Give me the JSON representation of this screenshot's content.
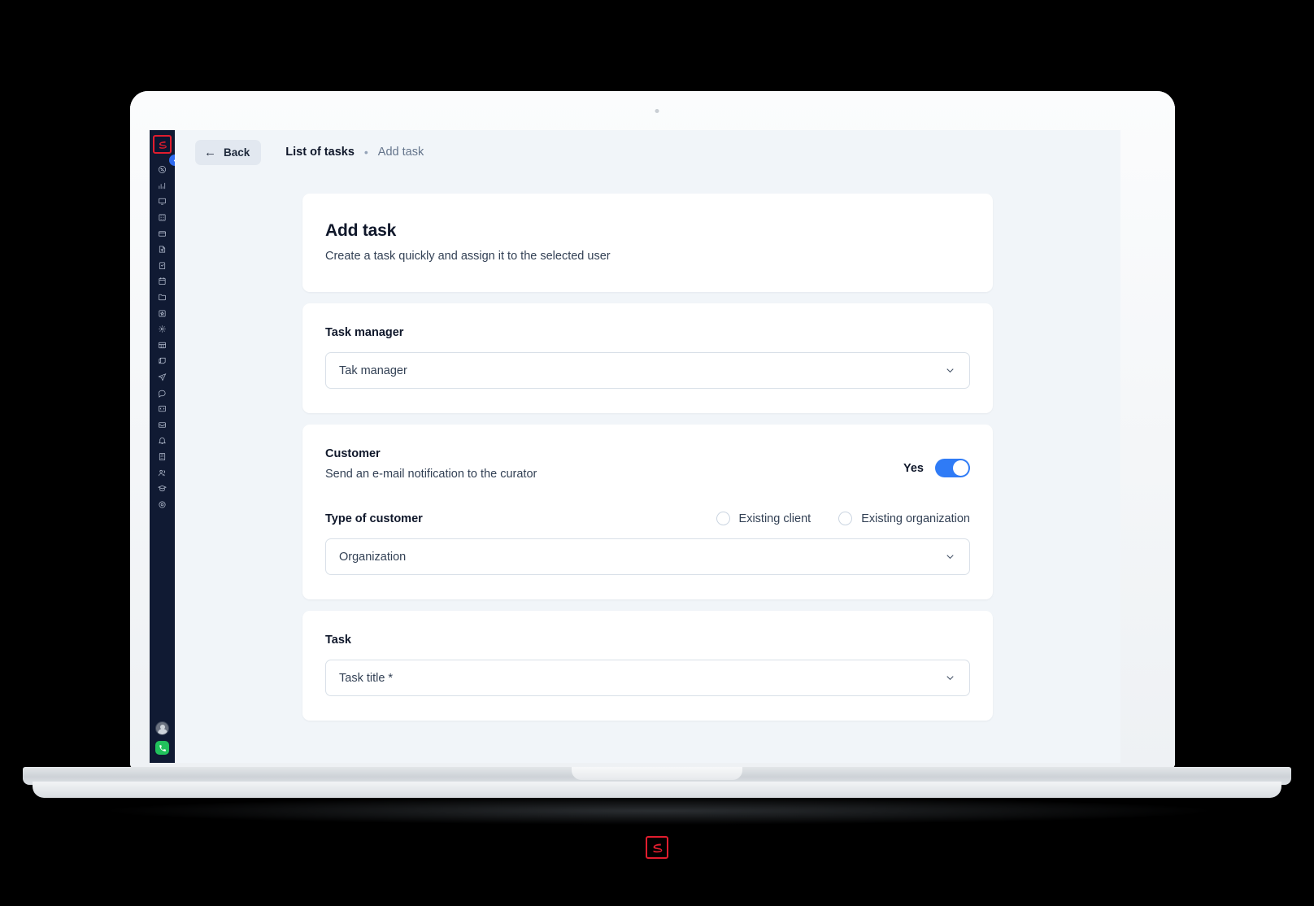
{
  "app": {
    "logo_name": "s-logo",
    "collapse_icon": "chevron-left-icon"
  },
  "sidebar": {
    "items": [
      {
        "icon": "percent-badge-icon",
        "label": "Discounts"
      },
      {
        "icon": "analytics-chart-icon",
        "label": "Analytics"
      },
      {
        "icon": "monitor-icon",
        "label": "Desktop"
      },
      {
        "icon": "building-icon",
        "label": "Company"
      },
      {
        "icon": "card-icon",
        "label": "Cards"
      },
      {
        "icon": "document-edit-icon",
        "label": "Documents"
      },
      {
        "icon": "clipboard-check-icon",
        "label": "Tasks"
      },
      {
        "icon": "calendar-icon",
        "label": "Calendar"
      },
      {
        "icon": "folder-icon",
        "label": "Files"
      },
      {
        "icon": "box-star-icon",
        "label": "Products"
      },
      {
        "icon": "settings-gear-icon",
        "label": "Configuration"
      },
      {
        "icon": "grid-table-icon",
        "label": "Tables"
      },
      {
        "icon": "archive-icon",
        "label": "Archive"
      },
      {
        "icon": "send-icon",
        "label": "Send"
      },
      {
        "icon": "chat-icon",
        "label": "Chat"
      },
      {
        "icon": "code-icon",
        "label": "Code"
      },
      {
        "icon": "inbox-icon",
        "label": "Inbox"
      },
      {
        "icon": "bell-icon",
        "label": "Notifications"
      },
      {
        "icon": "calculator-icon",
        "label": "Calculator"
      },
      {
        "icon": "users-icon",
        "label": "Users"
      },
      {
        "icon": "graduation-cap-icon",
        "label": "Learning"
      },
      {
        "icon": "gear-icon",
        "label": "Settings"
      }
    ],
    "avatar_name": "user-avatar",
    "support_button": {
      "icon": "support-phone-icon",
      "color": "#21c15c"
    }
  },
  "topbar": {
    "back_label": "Back",
    "back_icon": "arrow-left-icon",
    "breadcrumb": {
      "parent": "List of tasks",
      "separator": "•",
      "current": "Add task"
    }
  },
  "main": {
    "header_card": {
      "title": "Add task",
      "subtitle": "Create a task quickly and assign it to the selected user"
    },
    "task_manager_card": {
      "label": "Task manager",
      "select_placeholder": "Tak manager",
      "chevron_icon": "chevron-down-icon"
    },
    "customer_card": {
      "title": "Customer",
      "description": "Send an e-mail notification to the curator",
      "toggle_label": "Yes",
      "toggle_on": true,
      "toggle_color": "#2f7bf6",
      "type_label": "Type of customer",
      "radios": [
        {
          "label": "Existing client",
          "selected": false
        },
        {
          "label": "Existing organization",
          "selected": false
        }
      ],
      "select_value": "Organization",
      "chevron_icon": "chevron-down-icon"
    },
    "task_card": {
      "label": "Task",
      "select_placeholder": "Task title *",
      "chevron_icon": "chevron-down-icon"
    }
  },
  "watermark": {
    "name": "s-logo-watermark",
    "color": "#e11d2e"
  }
}
